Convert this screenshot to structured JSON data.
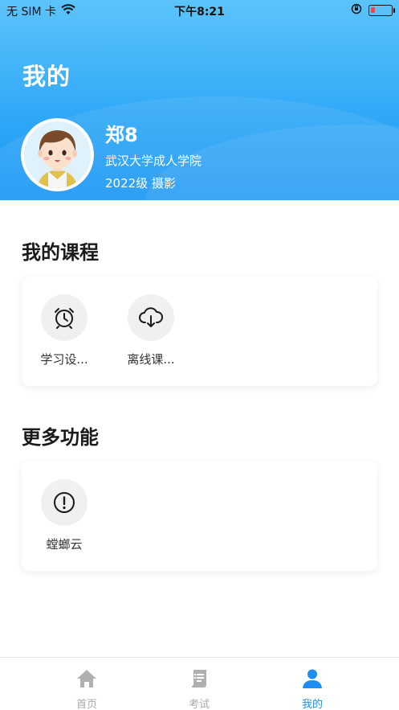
{
  "status_bar": {
    "carrier": "无 SIM 卡",
    "time": "下午8:21"
  },
  "header": {
    "title": "我的"
  },
  "profile": {
    "name": "郑8",
    "school": "武汉大学成人学院",
    "grade_major": "2022级 摄影"
  },
  "my_courses": {
    "title": "我的课程",
    "items": [
      {
        "label": "学习设...",
        "icon": "alarm-clock-icon"
      },
      {
        "label": "离线课...",
        "icon": "cloud-download-icon"
      }
    ]
  },
  "more_features": {
    "title": "更多功能",
    "items": [
      {
        "label": "螳螂云",
        "icon": "exclamation-circle-icon"
      }
    ]
  },
  "tabbar": {
    "tabs": [
      {
        "label": "首页",
        "icon": "home-icon",
        "active": false
      },
      {
        "label": "考试",
        "icon": "exam-scroll-icon",
        "active": false
      },
      {
        "label": "我的",
        "icon": "user-icon",
        "active": true
      }
    ],
    "active_color": "#1e8ff0",
    "inactive_color": "#aaaaaa"
  },
  "colors": {
    "header_gradient_top": "#5cc4fb",
    "header_gradient_bottom": "#1c97f5"
  }
}
